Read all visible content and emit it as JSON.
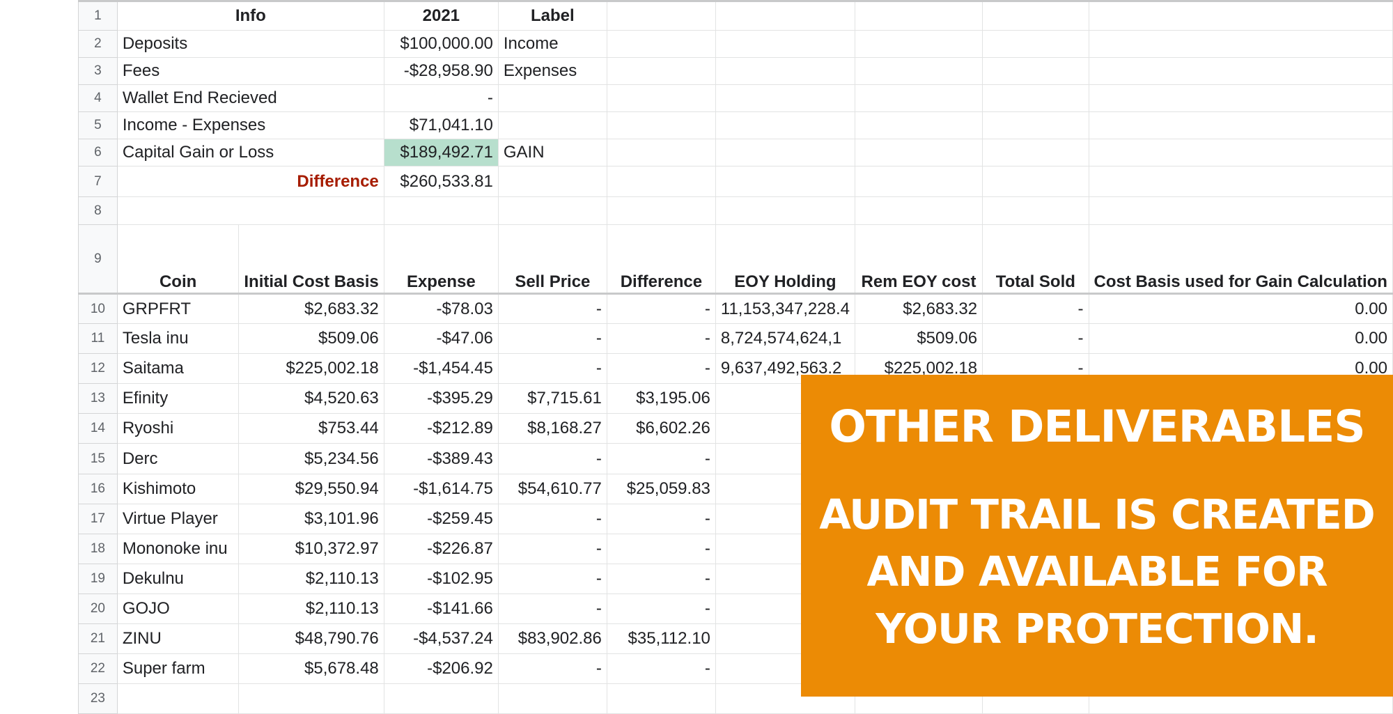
{
  "summary": {
    "header": {
      "info": "Info",
      "year": "2021",
      "label": "Label"
    },
    "deposits": {
      "label": "Deposits",
      "value": "$100,000.00",
      "tag": "Income"
    },
    "fees": {
      "label": "Fees",
      "value": "-$28,958.90",
      "tag": "Expenses"
    },
    "wallet_end": {
      "label": "Wallet End Recieved",
      "value": "-"
    },
    "income_minus_expenses": {
      "label": "Income - Expenses",
      "value": "$71,041.10"
    },
    "capital_gain": {
      "label": "Capital Gain or Loss",
      "value": "$189,492.71",
      "tag": "GAIN",
      "highlight_color": "#b7dfcd"
    },
    "difference": {
      "label": "Difference",
      "value": "$260,533.81",
      "label_color": "#a61c00"
    }
  },
  "row_numbers": [
    "1",
    "2",
    "3",
    "4",
    "5",
    "6",
    "7",
    "8",
    "9",
    "10",
    "11",
    "12",
    "13",
    "14",
    "15",
    "16",
    "17",
    "18",
    "19",
    "20",
    "21",
    "22",
    "23"
  ],
  "coins_table": {
    "headers": {
      "coin": "Coin",
      "initial_cost_basis": "Initial Cost Basis",
      "expense": "Expense",
      "sell_price": "Sell Price",
      "difference": "Difference",
      "eoy_holding": "EOY Holding",
      "rem_eoy_cost": "Rem EOY cost",
      "total_sold": "Total Sold",
      "cost_basis_gain": "Cost Basis used for Gain Calculation"
    },
    "rows": [
      {
        "coin": "GRPFRT",
        "initial": "$2,683.32",
        "expense": "-$78.03",
        "sell": "-",
        "difference": "-",
        "eoy": "11,153,347,228.4",
        "rem": "$2,683.32",
        "sold": "-",
        "basis": "0.00"
      },
      {
        "coin": "Tesla inu",
        "initial": "$509.06",
        "expense": "-$47.06",
        "sell": "-",
        "difference": "-",
        "eoy": "8,724,574,624,1",
        "rem": "$509.06",
        "sold": "-",
        "basis": "0.00"
      },
      {
        "coin": "Saitama",
        "initial": "$225,002.18",
        "expense": "-$1,454.45",
        "sell": "-",
        "difference": "-",
        "eoy": "9,637,492,563.2",
        "rem": "$225,002.18",
        "sold": "-",
        "basis": "0.00"
      },
      {
        "coin": "Efinity",
        "initial": "$4,520.63",
        "expense": "-$395.29",
        "sell": "$7,715.61",
        "difference": "$3,195.06",
        "eoy": "",
        "rem": "",
        "sold": "",
        "basis": ""
      },
      {
        "coin": "Ryoshi",
        "initial": "$753.44",
        "expense": "-$212.89",
        "sell": "$8,168.27",
        "difference": "$6,602.26",
        "eoy": "",
        "rem": "",
        "sold": "",
        "basis": ""
      },
      {
        "coin": "Derc",
        "initial": "$5,234.56",
        "expense": "-$389.43",
        "sell": "-",
        "difference": "-",
        "eoy": "",
        "rem": "",
        "sold": "",
        "basis": ""
      },
      {
        "coin": "Kishimoto",
        "initial": "$29,550.94",
        "expense": "-$1,614.75",
        "sell": "$54,610.77",
        "difference": "$25,059.83",
        "eoy": "",
        "rem": "",
        "sold": "",
        "basis": ""
      },
      {
        "coin": "Virtue Player",
        "initial": "$3,101.96",
        "expense": "-$259.45",
        "sell": "-",
        "difference": "-",
        "eoy": "",
        "rem": "",
        "sold": "",
        "basis": ""
      },
      {
        "coin": "Mononoke inu",
        "initial": "$10,372.97",
        "expense": "-$226.87",
        "sell": "-",
        "difference": "-",
        "eoy": "",
        "rem": "",
        "sold": "",
        "basis": ""
      },
      {
        "coin": "Dekulnu",
        "initial": "$2,110.13",
        "expense": "-$102.95",
        "sell": "-",
        "difference": "-",
        "eoy": "",
        "rem": "",
        "sold": "",
        "basis": ""
      },
      {
        "coin": "GOJO",
        "initial": "$2,110.13",
        "expense": "-$141.66",
        "sell": "-",
        "difference": "-",
        "eoy": "",
        "rem": "",
        "sold": "",
        "basis": ""
      },
      {
        "coin": "ZINU",
        "initial": "$48,790.76",
        "expense": "-$4,537.24",
        "sell": "$83,902.86",
        "difference": "$35,112.10",
        "eoy": "",
        "rem": "",
        "sold": "",
        "basis": ""
      },
      {
        "coin": "Super farm",
        "initial": "$5,678.48",
        "expense": "-$206.92",
        "sell": "-",
        "difference": "-",
        "eoy": "",
        "rem": "",
        "sold": "",
        "basis": ""
      }
    ]
  },
  "overlay": {
    "title": "OTHER DELIVERABLES",
    "lines": [
      "AUDIT TRAIL IS CREATED",
      "AND AVAILABLE FOR",
      "YOUR PROTECTION."
    ],
    "background": "#ec8b05"
  }
}
